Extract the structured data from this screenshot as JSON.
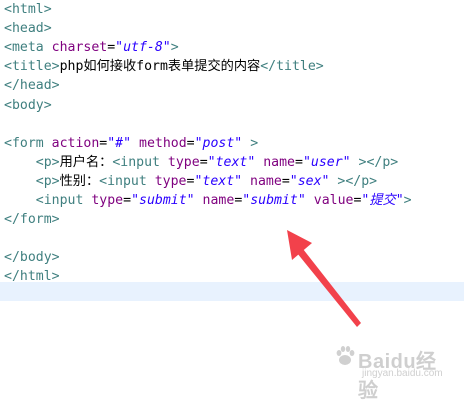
{
  "editor": {
    "lines": [
      [
        {
          "t": "tag",
          "v": "<html>"
        }
      ],
      [
        {
          "t": "tag",
          "v": "<head>"
        }
      ],
      [
        {
          "t": "tag",
          "v": "<meta "
        },
        {
          "t": "attr",
          "v": "charset"
        },
        {
          "t": "txt",
          "v": "="
        },
        {
          "t": "val",
          "v": "\"utf-8\""
        },
        {
          "t": "tag",
          "v": ">"
        }
      ],
      [
        {
          "t": "tag",
          "v": "<title>"
        },
        {
          "t": "txt",
          "v": "php如何接收form表单提交的内容"
        },
        {
          "t": "tag",
          "v": "</title>"
        }
      ],
      [
        {
          "t": "tag",
          "v": "</head>"
        }
      ],
      [
        {
          "t": "tag",
          "v": "<body>"
        }
      ],
      [],
      [
        {
          "t": "tag",
          "v": "<form "
        },
        {
          "t": "attr",
          "v": "action"
        },
        {
          "t": "txt",
          "v": "="
        },
        {
          "t": "val",
          "v": "\"#\""
        },
        {
          "t": "txt",
          "v": " "
        },
        {
          "t": "attr",
          "v": "method"
        },
        {
          "t": "txt",
          "v": "="
        },
        {
          "t": "val",
          "v": "\"post\""
        },
        {
          "t": "txt",
          "v": " "
        },
        {
          "t": "tag",
          "v": ">"
        }
      ],
      [
        {
          "t": "txt",
          "v": "    "
        },
        {
          "t": "tag",
          "v": "<p>"
        },
        {
          "t": "txt",
          "v": "用户名："
        },
        {
          "t": "tag",
          "v": "<input "
        },
        {
          "t": "attr",
          "v": "type"
        },
        {
          "t": "txt",
          "v": "="
        },
        {
          "t": "val",
          "v": "\"text\""
        },
        {
          "t": "txt",
          "v": " "
        },
        {
          "t": "attr",
          "v": "name"
        },
        {
          "t": "txt",
          "v": "="
        },
        {
          "t": "val",
          "v": "\"user\""
        },
        {
          "t": "txt",
          "v": " "
        },
        {
          "t": "tag",
          "v": "></p>"
        }
      ],
      [
        {
          "t": "txt",
          "v": "    "
        },
        {
          "t": "tag",
          "v": "<p>"
        },
        {
          "t": "txt",
          "v": "性别："
        },
        {
          "t": "tag",
          "v": "<input "
        },
        {
          "t": "attr",
          "v": "type"
        },
        {
          "t": "txt",
          "v": "="
        },
        {
          "t": "val",
          "v": "\"text\""
        },
        {
          "t": "txt",
          "v": " "
        },
        {
          "t": "attr",
          "v": "name"
        },
        {
          "t": "txt",
          "v": "="
        },
        {
          "t": "val",
          "v": "\"sex\""
        },
        {
          "t": "txt",
          "v": " "
        },
        {
          "t": "tag",
          "v": "></p>"
        }
      ],
      [
        {
          "t": "txt",
          "v": "    "
        },
        {
          "t": "tag",
          "v": "<input "
        },
        {
          "t": "attr",
          "v": "type"
        },
        {
          "t": "txt",
          "v": "="
        },
        {
          "t": "val",
          "v": "\"submit\""
        },
        {
          "t": "txt",
          "v": " "
        },
        {
          "t": "attr",
          "v": "name"
        },
        {
          "t": "txt",
          "v": "="
        },
        {
          "t": "val",
          "v": "\"submit\""
        },
        {
          "t": "txt",
          "v": " "
        },
        {
          "t": "attr",
          "v": "value"
        },
        {
          "t": "txt",
          "v": "="
        },
        {
          "t": "val",
          "v": "\"提交\""
        },
        {
          "t": "tag",
          "v": ">"
        }
      ],
      [
        {
          "t": "tag",
          "v": "</form>"
        }
      ],
      [],
      [
        {
          "t": "tag",
          "v": "</body>"
        }
      ],
      [
        {
          "t": "tag",
          "v": "</html>"
        }
      ]
    ]
  },
  "colors": {
    "tag": "#3f7f7f",
    "attr": "#7f007f",
    "value": "#2a00ff",
    "current_line": "#e8f2fe",
    "arrow": "#f2414b"
  },
  "annotation": {
    "icon": "red-arrow-icon"
  },
  "watermark": {
    "logo": "Baidu经验",
    "sub": "jingyan.baidu.com"
  }
}
